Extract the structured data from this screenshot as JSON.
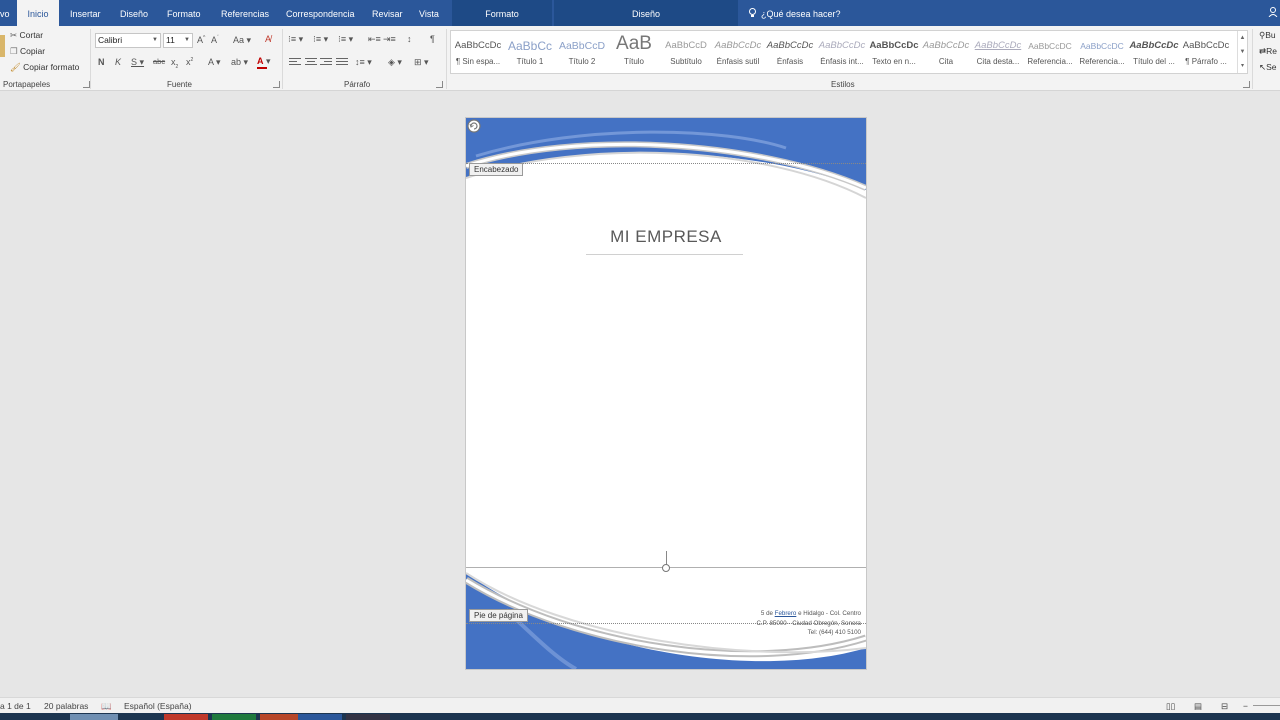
{
  "tabs": [
    "vo",
    "Inicio",
    "Insertar",
    "Diseño",
    "Formato",
    "Referencias",
    "Correspondencia",
    "Revisar",
    "Vista"
  ],
  "context_tabs": [
    "Formato",
    "Diseño"
  ],
  "tell_me": "¿Qué desea hacer?",
  "clipboard": {
    "cut": "Cortar",
    "copy": "Copiar",
    "format_painter": "Copiar formato",
    "label": "Portapapeles"
  },
  "font": {
    "name": "Calibri",
    "size": "11",
    "label": "Fuente"
  },
  "paragraph_label": "Párrafo",
  "styles_label": "Estilos",
  "styles": [
    {
      "preview": "AaBbCcDc",
      "name": "¶ Sin espa..."
    },
    {
      "preview": "AaBbCc",
      "name": "Título 1"
    },
    {
      "preview": "AaBbCcD",
      "name": "Título 2"
    },
    {
      "preview": "AaB",
      "name": "Título"
    },
    {
      "preview": "AaBbCcD",
      "name": "Subtítulo"
    },
    {
      "preview": "AaBbCcDc",
      "name": "Énfasis sutil"
    },
    {
      "preview": "AaBbCcDc",
      "name": "Énfasis"
    },
    {
      "preview": "AaBbCcDc",
      "name": "Énfasis int..."
    },
    {
      "preview": "AaBbCcDc",
      "name": "Texto en n..."
    },
    {
      "preview": "AaBbCcDc",
      "name": "Cita"
    },
    {
      "preview": "AaBbCcDc",
      "name": "Cita desta..."
    },
    {
      "preview": "AaBbCcDC",
      "name": "Referencia..."
    },
    {
      "preview": "AaBbCcDC",
      "name": "Referencia..."
    },
    {
      "preview": "AaBbCcDc",
      "name": "Título del ..."
    },
    {
      "preview": "AaBbCcDc",
      "name": "¶ Párrafo ..."
    }
  ],
  "editing": [
    "Bu",
    "Re",
    "Se"
  ],
  "document": {
    "header_tag": "Encabezado",
    "footer_tag": "Pie de página",
    "company": "MI EMPRESA",
    "footer_line1_pre": "5 de ",
    "footer_line1_link": "Febrero",
    "footer_line1_post": " e Hidalgo - Col. Centro",
    "footer_line2": "C.P. 85000 - Ciudad Obregón, Sonora",
    "footer_line3": "Tel: (644) 410 5100"
  },
  "status": {
    "page": "a 1 de 1",
    "words": "20 palabras",
    "language": "Español (España)"
  },
  "colors": {
    "ribbon_blue": "#2b579a",
    "page_blue": "#4472c4"
  }
}
